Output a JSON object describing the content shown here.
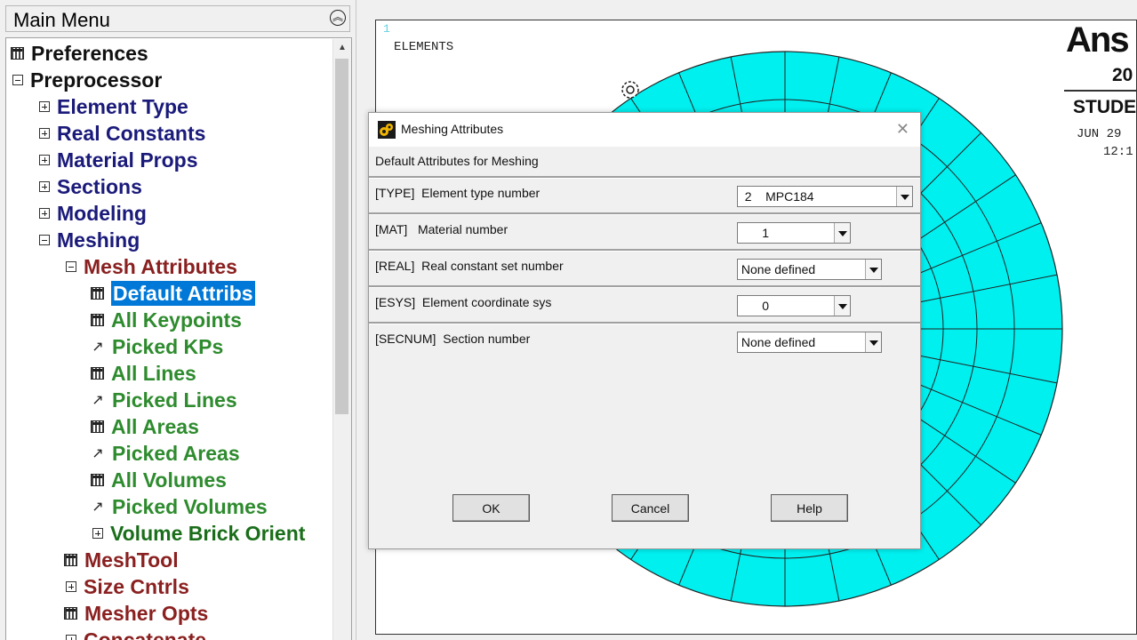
{
  "menu": {
    "title": "Main Menu",
    "items": [
      {
        "label": "Preferences",
        "icon": "calculator-icon"
      },
      {
        "label": "Preprocessor",
        "icon": "collapse-icon"
      },
      {
        "label": "Element Type",
        "icon": "expand-icon"
      },
      {
        "label": "Real Constants",
        "icon": "expand-icon"
      },
      {
        "label": "Material Props",
        "icon": "expand-icon"
      },
      {
        "label": "Sections",
        "icon": "expand-icon"
      },
      {
        "label": "Modeling",
        "icon": "expand-icon"
      },
      {
        "label": "Meshing",
        "icon": "collapse-icon"
      },
      {
        "label": "Mesh Attributes",
        "icon": "collapse-icon"
      },
      {
        "label": "Default Attribs",
        "icon": "calculator-icon",
        "selected": true
      },
      {
        "label": "All Keypoints",
        "icon": "calculator-icon"
      },
      {
        "label": "Picked KPs",
        "icon": "pick-arrow-icon"
      },
      {
        "label": "All Lines",
        "icon": "calculator-icon"
      },
      {
        "label": "Picked Lines",
        "icon": "pick-arrow-icon"
      },
      {
        "label": "All Areas",
        "icon": "calculator-icon"
      },
      {
        "label": "Picked Areas",
        "icon": "pick-arrow-icon"
      },
      {
        "label": "All Volumes",
        "icon": "calculator-icon"
      },
      {
        "label": "Picked Volumes",
        "icon": "pick-arrow-icon"
      },
      {
        "label": "Volume Brick Orient",
        "icon": "expand-icon"
      },
      {
        "label": "MeshTool",
        "icon": "calculator-icon"
      },
      {
        "label": "Size Cntrls",
        "icon": "expand-icon"
      },
      {
        "label": "Mesher Opts",
        "icon": "calculator-icon"
      },
      {
        "label": "Concatenate",
        "icon": "expand-icon"
      }
    ]
  },
  "graphics": {
    "window_number": "1",
    "label": "ELEMENTS",
    "logo": "Ans",
    "logo_year": "20",
    "edition": "STUDE",
    "date": "JUN 29",
    "time": "12:1",
    "mesh_color": "#00f0f0"
  },
  "dialog": {
    "title": "Meshing Attributes",
    "subheading": "Default Attributes for Meshing",
    "rows": [
      {
        "label": "[TYPE]  Element type number",
        "value": "  2    MPC184"
      },
      {
        "label": "[MAT]   Material number",
        "value": "       1"
      },
      {
        "label": "[REAL]  Real constant set number",
        "value": " None defined"
      },
      {
        "label": "[ESYS]  Element coordinate sys",
        "value": "       0"
      },
      {
        "label": "[SECNUM]  Section number",
        "value": " None defined"
      }
    ],
    "ok_label": "OK",
    "cancel_label": "Cancel",
    "help_label": "Help"
  },
  "colors": {
    "selection": "#0078d7",
    "navy": "#1a1a7a",
    "maroon": "#8a2020",
    "green": "#2e8b2e"
  }
}
